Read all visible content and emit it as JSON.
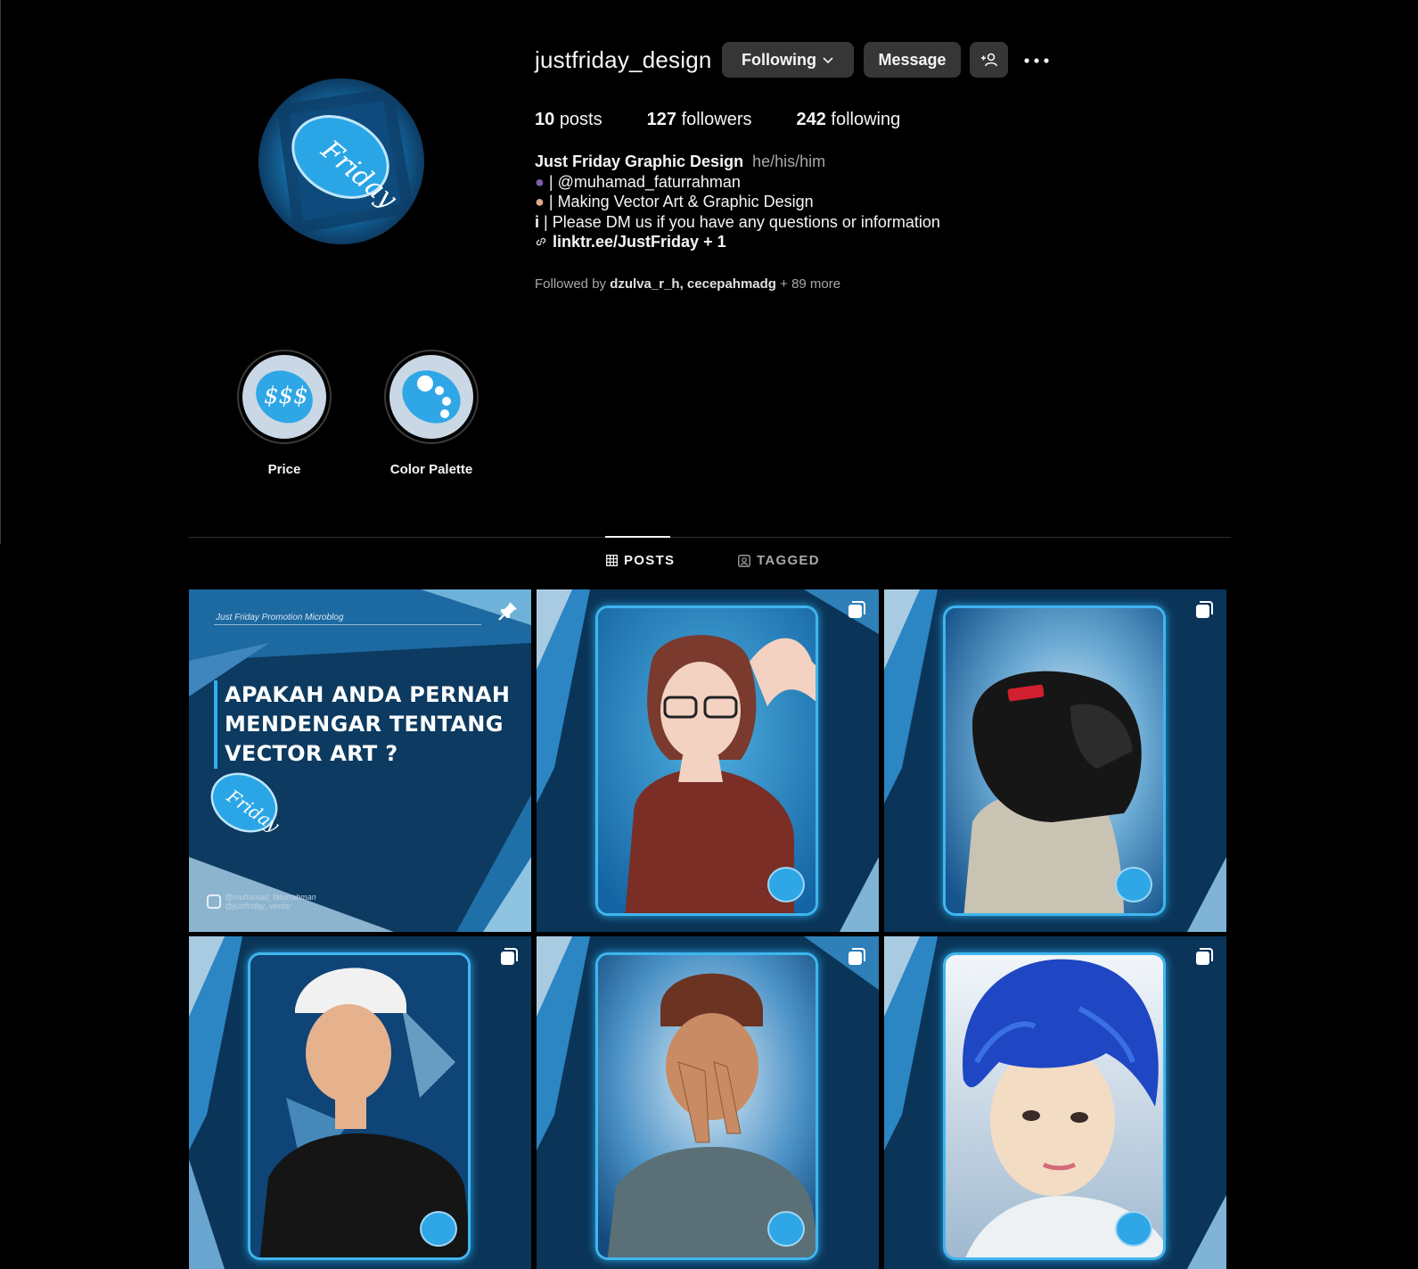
{
  "profile": {
    "username": "justfriday_design",
    "following_label": "Following",
    "message_label": "Message",
    "stats": {
      "posts_count": "10",
      "posts_label": "posts",
      "followers_count": "127",
      "followers_label": "followers",
      "following_count": "242",
      "following_label": "following"
    },
    "bio": {
      "full_name": "Just Friday Graphic Design",
      "pronouns": "he/his/him",
      "line1": "| @muhamad_faturrahman",
      "line2": "| Making Vector Art & Graphic Design",
      "line3": "| Please DM us if you have any questions or information",
      "link": "linktr.ee/JustFriday + 1"
    },
    "followed_by": {
      "prefix": "Followed by",
      "user1": "dzulva_r_h,",
      "user2": "cecepahmadg",
      "suffix": "+ 89 more"
    }
  },
  "highlights": [
    {
      "label": "Price",
      "icon": "dollar-signs-icon"
    },
    {
      "label": "Color Palette",
      "icon": "palette-icon"
    }
  ],
  "tabs": {
    "posts": "POSTS",
    "tagged": "TAGGED",
    "active": "posts"
  },
  "posts": [
    {
      "type": "promo",
      "pinned": true,
      "header": "Just Friday Promotion Microblog",
      "title_line1": "APAKAH ANDA PERNAH",
      "title_line2": "MENDENGAR TENTANG",
      "title_line3": "VECTOR ART ?",
      "handle1": "@muhamad_faturrahman",
      "handle2": "@justfriday_vector"
    },
    {
      "type": "carousel",
      "subject": "woman with glasses"
    },
    {
      "type": "carousel",
      "subject": "person with black helmet"
    },
    {
      "type": "carousel",
      "subject": "man with white beanie"
    },
    {
      "type": "carousel",
      "subject": "man with peace sign"
    },
    {
      "type": "carousel",
      "subject": "man with blue hair"
    }
  ],
  "colors": {
    "background": "#000000",
    "button": "#363636",
    "accent_blue": "#2fa7e6",
    "post_navy": "#0b3558"
  }
}
